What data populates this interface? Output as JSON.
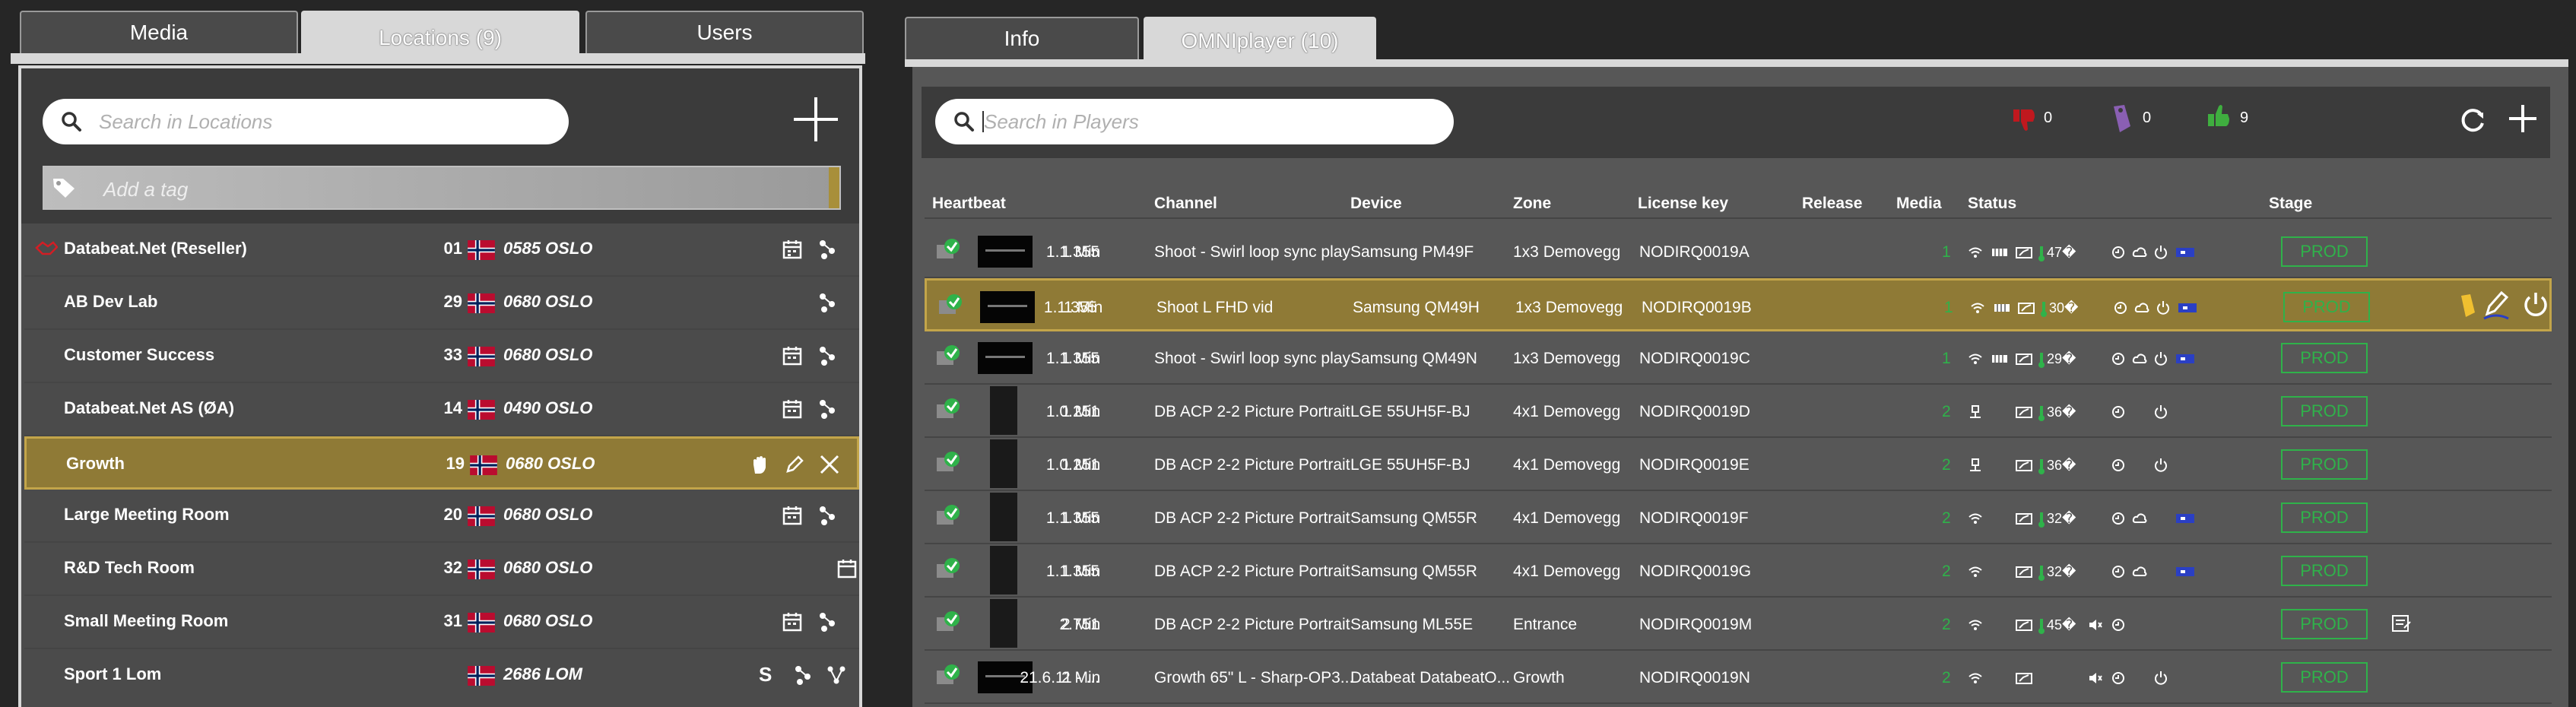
{
  "left_tabs": [
    "Media",
    "Locations (9)",
    "Users"
  ],
  "right_tabs": [
    "Info",
    "OMNIplayer (10)"
  ],
  "locations": {
    "search_placeholder": "Search in Locations",
    "tag_placeholder": "Add a tag",
    "rows": [
      {
        "name": "Databeat.Net (Reseller)",
        "num": "01",
        "city": "0585 OSLO"
      },
      {
        "name": "AB Dev Lab",
        "num": "29",
        "city": "0680 OSLO"
      },
      {
        "name": "Customer Success",
        "num": "33",
        "city": "0680 OSLO"
      },
      {
        "name": "Databeat.Net AS (ØA)",
        "num": "14",
        "city": "0490 OSLO"
      },
      {
        "name": "Growth",
        "num": "19",
        "city": "0680 OSLO"
      },
      {
        "name": "Large Meeting Room",
        "num": "20",
        "city": "0680 OSLO"
      },
      {
        "name": "R&D Tech Room",
        "num": "32",
        "city": "0680 OSLO"
      },
      {
        "name": "Small Meeting Room",
        "num": "31",
        "city": "0680 OSLO"
      },
      {
        "name": "Sport 1 Lom",
        "num": "",
        "city": "2686 LOM"
      }
    ],
    "s_badge": "S"
  },
  "players": {
    "search_placeholder": "Search in Players",
    "counts": {
      "down": "0",
      "tag": "0",
      "up": "9"
    },
    "headers": {
      "heartbeat": "Heartbeat",
      "channel": "Channel",
      "device": "Device",
      "zone": "Zone",
      "license": "License key",
      "release": "Release",
      "media": "Media",
      "status": "Status",
      "stage": "Stage"
    },
    "rows": [
      {
        "time": "1 Min",
        "channel": "Shoot - Swirl loop sync play",
        "device": "Samsung PM49F",
        "zone": "1x3 Demovegg",
        "license": "NODIRQ0019A",
        "release": "1.1.355",
        "media": "1",
        "temp": "47�",
        "stage": "PROD"
      },
      {
        "time": "1 Min",
        "channel": "Shoot L FHD vid",
        "device": "Samsung QM49H",
        "zone": "1x3 Demovegg",
        "license": "NODIRQ0019B",
        "release": "1.1.355",
        "media": "1",
        "temp": "30�",
        "stage": "PROD"
      },
      {
        "time": "1 Min",
        "channel": "Shoot - Swirl loop sync play",
        "device": "Samsung QM49N",
        "zone": "1x3 Demovegg",
        "license": "NODIRQ0019C",
        "release": "1.1.355",
        "media": "1",
        "temp": "29�",
        "stage": "PROD"
      },
      {
        "time": "1 Min",
        "channel": "DB ACP 2-2 Picture Portrait",
        "device": "LGE 55UH5F-BJ",
        "zone": "4x1 Demovegg",
        "license": "NODIRQ0019D",
        "release": "1.0.251",
        "media": "2",
        "temp": "36�",
        "stage": "PROD"
      },
      {
        "time": "1 Min",
        "channel": "DB ACP 2-2 Picture Portrait",
        "device": "LGE 55UH5F-BJ",
        "zone": "4x1 Demovegg",
        "license": "NODIRQ0019E",
        "release": "1.0.251",
        "media": "2",
        "temp": "36�",
        "stage": "PROD"
      },
      {
        "time": "1 Min",
        "channel": "DB ACP 2-2 Picture Portrait",
        "device": "Samsung QM55R",
        "zone": "4x1 Demovegg",
        "license": "NODIRQ0019F",
        "release": "1.1.355",
        "media": "2",
        "temp": "32�",
        "stage": "PROD"
      },
      {
        "time": "1 Min",
        "channel": "DB ACP 2-2 Picture Portrait",
        "device": "Samsung QM55R",
        "zone": "4x1 Demovegg",
        "license": "NODIRQ0019G",
        "release": "1.1.355",
        "media": "2",
        "temp": "32�",
        "stage": "PROD"
      },
      {
        "time": "2 Min",
        "channel": "DB ACP 2-2 Picture Portrait",
        "device": "Samsung ML55E",
        "zone": "Entrance",
        "license": "NODIRQ0019M",
        "release": "2.751",
        "media": "2",
        "temp": "45�",
        "stage": "PROD"
      },
      {
        "time": "2 Min",
        "channel": "Growth 65\" L - Sharp-OP3...",
        "device": "Databeat DatabeatO...",
        "zone": "Growth",
        "license": "NODIRQ0019N",
        "release": "21.6.11 - ...",
        "media": "2",
        "temp": "",
        "stage": "PROD"
      }
    ]
  },
  "colors": {
    "accent": "#a88f3a",
    "prod": "#2fb24a",
    "media_count": "#2fb24a",
    "thumb_down": "#c0181e",
    "thumb_up": "#3fae3f",
    "tag": "#8a5fb3"
  }
}
